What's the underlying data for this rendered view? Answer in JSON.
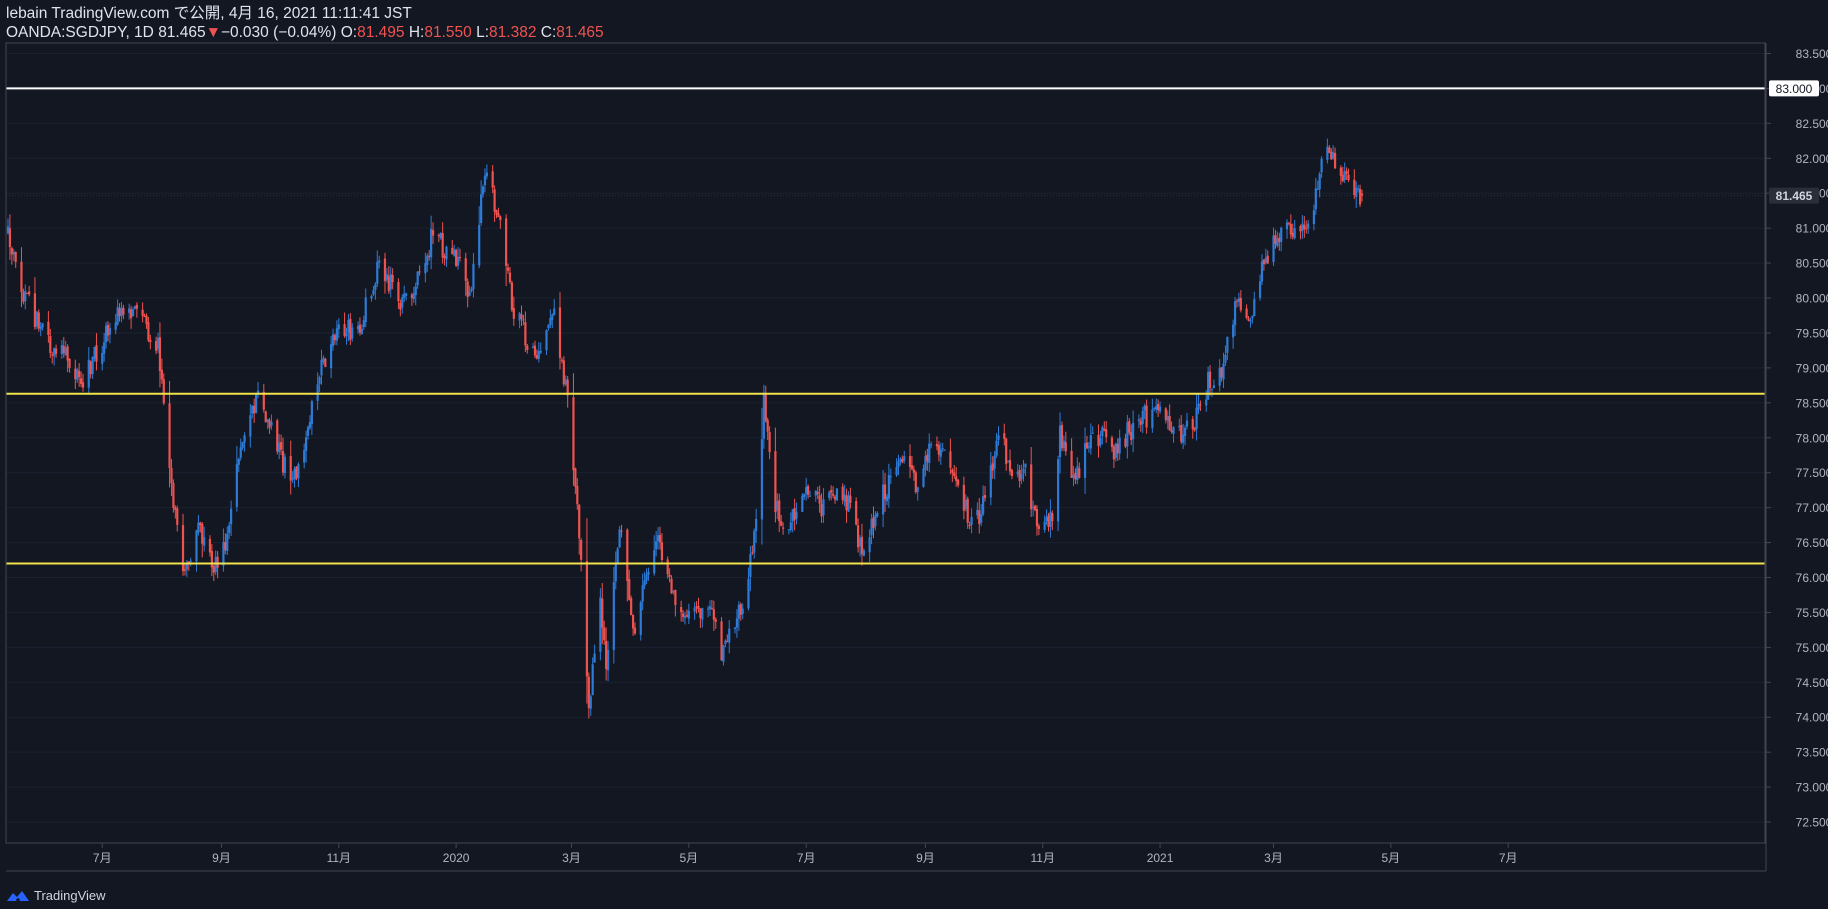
{
  "header": {
    "publish_line": "lebain TradingView.com で公開, 4月 16, 2021 11:11:41 JST",
    "symbol": "OANDA:SGDJPY, 1D",
    "last": "81.465",
    "change_arrow": "▼",
    "change": "−0.030 (−0.04%)",
    "o_label": "O:",
    "o_value": "81.495",
    "h_label": "H:",
    "h_value": "81.550",
    "l_label": "L:",
    "l_value": "81.382",
    "c_label": "C:",
    "c_value": "81.465"
  },
  "footer": {
    "brand": "TradingView",
    "logo_icon": "tradingview-logo-icon"
  },
  "colors": {
    "background": "#131722",
    "up": "#2e7bd6",
    "down": "#ef5350",
    "axis_text": "#b2b5be",
    "border": "#434651",
    "horizontal_line_white": "#ffffff",
    "horizontal_line_yellow": "#f0e24b"
  },
  "chart_data": {
    "type": "candlestick",
    "symbol": "OANDA:SGDJPY",
    "interval": "1D",
    "ylim": [
      72.2,
      83.65
    ],
    "y_ticks": [
      "72.500",
      "73.000",
      "73.500",
      "74.000",
      "74.500",
      "75.000",
      "75.500",
      "76.000",
      "76.500",
      "77.000",
      "77.500",
      "78.000",
      "78.500",
      "79.000",
      "79.500",
      "80.000",
      "80.500",
      "81.000",
      "81.500",
      "82.000",
      "82.500",
      "83.000",
      "83.500"
    ],
    "x_ticks": [
      {
        "label": "7月",
        "date": "2019-07"
      },
      {
        "label": "9月",
        "date": "2019-09"
      },
      {
        "label": "11月",
        "date": "2019-11"
      },
      {
        "label": "2020",
        "date": "2020-01"
      },
      {
        "label": "3月",
        "date": "2020-03"
      },
      {
        "label": "5月",
        "date": "2020-05"
      },
      {
        "label": "7月",
        "date": "2020-07"
      },
      {
        "label": "9月",
        "date": "2020-09"
      },
      {
        "label": "11月",
        "date": "2020-11"
      },
      {
        "label": "2021",
        "date": "2021-01"
      },
      {
        "label": "3月",
        "date": "2021-03"
      },
      {
        "label": "5月",
        "date": "2021-05"
      },
      {
        "label": "7月",
        "date": "2021-07"
      }
    ],
    "horizontal_lines": [
      {
        "value": 83.0,
        "color": "white",
        "label": "83.000"
      },
      {
        "value": 78.63,
        "color": "yellow"
      },
      {
        "value": 76.2,
        "color": "yellow"
      }
    ],
    "last_price": {
      "value": 81.465,
      "label": "81.465"
    },
    "price_path": [
      {
        "date": "2019-05-13",
        "close": 80.9
      },
      {
        "date": "2019-05-20",
        "close": 80.1
      },
      {
        "date": "2019-06-05",
        "close": 79.3
      },
      {
        "date": "2019-06-10",
        "close": 79.4
      },
      {
        "date": "2019-06-20",
        "close": 78.8
      },
      {
        "date": "2019-06-28",
        "close": 79.2
      },
      {
        "date": "2019-07-10",
        "close": 79.9
      },
      {
        "date": "2019-07-22",
        "close": 79.7
      },
      {
        "date": "2019-07-30",
        "close": 79.3
      },
      {
        "date": "2019-08-02",
        "close": 78.4
      },
      {
        "date": "2019-08-06",
        "close": 77.2
      },
      {
        "date": "2019-08-13",
        "close": 76.0
      },
      {
        "date": "2019-08-20",
        "close": 76.8
      },
      {
        "date": "2019-08-27",
        "close": 76.1
      },
      {
        "date": "2019-09-03",
        "close": 76.4
      },
      {
        "date": "2019-09-10",
        "close": 77.7
      },
      {
        "date": "2019-09-20",
        "close": 78.6
      },
      {
        "date": "2019-09-27",
        "close": 78.1
      },
      {
        "date": "2019-10-03",
        "close": 77.6
      },
      {
        "date": "2019-10-08",
        "close": 77.4
      },
      {
        "date": "2019-10-14",
        "close": 77.9
      },
      {
        "date": "2019-10-22",
        "close": 79.0
      },
      {
        "date": "2019-10-31",
        "close": 79.5
      },
      {
        "date": "2019-11-12",
        "close": 79.6
      },
      {
        "date": "2019-11-22",
        "close": 80.5
      },
      {
        "date": "2019-12-03",
        "close": 79.9
      },
      {
        "date": "2019-12-11",
        "close": 80.2
      },
      {
        "date": "2019-12-20",
        "close": 80.9
      },
      {
        "date": "2020-01-02",
        "close": 80.5
      },
      {
        "date": "2020-01-08",
        "close": 80.0
      },
      {
        "date": "2020-01-13",
        "close": 81.2
      },
      {
        "date": "2020-01-17",
        "close": 81.8
      },
      {
        "date": "2020-01-24",
        "close": 81.1
      },
      {
        "date": "2020-01-31",
        "close": 79.8
      },
      {
        "date": "2020-02-07",
        "close": 79.4
      },
      {
        "date": "2020-02-14",
        "close": 79.2
      },
      {
        "date": "2020-02-21",
        "close": 79.9
      },
      {
        "date": "2020-02-25",
        "close": 79.0
      },
      {
        "date": "2020-02-28",
        "close": 78.5
      },
      {
        "date": "2020-03-03",
        "close": 77.3
      },
      {
        "date": "2020-03-06",
        "close": 76.3
      },
      {
        "date": "2020-03-10",
        "close": 74.2
      },
      {
        "date": "2020-03-16",
        "close": 75.6
      },
      {
        "date": "2020-03-19",
        "close": 74.6
      },
      {
        "date": "2020-03-26",
        "close": 76.7
      },
      {
        "date": "2020-04-03",
        "close": 75.2
      },
      {
        "date": "2020-04-09",
        "close": 76.1
      },
      {
        "date": "2020-04-16",
        "close": 76.5
      },
      {
        "date": "2020-04-23",
        "close": 75.7
      },
      {
        "date": "2020-05-01",
        "close": 75.4
      },
      {
        "date": "2020-05-11",
        "close": 75.7
      },
      {
        "date": "2020-05-18",
        "close": 74.9
      },
      {
        "date": "2020-05-25",
        "close": 75.3
      },
      {
        "date": "2020-06-01",
        "close": 76.0
      },
      {
        "date": "2020-06-05",
        "close": 76.9
      },
      {
        "date": "2020-06-09",
        "close": 78.5
      },
      {
        "date": "2020-06-15",
        "close": 77.0
      },
      {
        "date": "2020-06-22",
        "close": 76.7
      },
      {
        "date": "2020-06-30",
        "close": 77.2
      },
      {
        "date": "2020-07-10",
        "close": 77.0
      },
      {
        "date": "2020-07-21",
        "close": 77.2
      },
      {
        "date": "2020-07-31",
        "close": 76.3
      },
      {
        "date": "2020-08-07",
        "close": 77.0
      },
      {
        "date": "2020-08-14",
        "close": 77.4
      },
      {
        "date": "2020-08-21",
        "close": 77.8
      },
      {
        "date": "2020-08-28",
        "close": 77.3
      },
      {
        "date": "2020-09-04",
        "close": 77.9
      },
      {
        "date": "2020-09-11",
        "close": 77.7
      },
      {
        "date": "2020-09-18",
        "close": 77.4
      },
      {
        "date": "2020-09-25",
        "close": 76.7
      },
      {
        "date": "2020-10-02",
        "close": 77.1
      },
      {
        "date": "2020-10-09",
        "close": 78.0
      },
      {
        "date": "2020-10-16",
        "close": 77.6
      },
      {
        "date": "2020-10-23",
        "close": 77.5
      },
      {
        "date": "2020-10-30",
        "close": 76.6
      },
      {
        "date": "2020-11-06",
        "close": 76.8
      },
      {
        "date": "2020-11-10",
        "close": 78.1
      },
      {
        "date": "2020-11-18",
        "close": 77.4
      },
      {
        "date": "2020-11-25",
        "close": 77.9
      },
      {
        "date": "2020-12-02",
        "close": 78.0
      },
      {
        "date": "2020-12-09",
        "close": 77.8
      },
      {
        "date": "2020-12-16",
        "close": 78.1
      },
      {
        "date": "2020-12-23",
        "close": 78.3
      },
      {
        "date": "2021-01-05",
        "close": 78.3
      },
      {
        "date": "2021-01-12",
        "close": 78.0
      },
      {
        "date": "2021-01-19",
        "close": 78.2
      },
      {
        "date": "2021-01-26",
        "close": 78.8
      },
      {
        "date": "2021-02-02",
        "close": 78.9
      },
      {
        "date": "2021-02-09",
        "close": 79.9
      },
      {
        "date": "2021-02-16",
        "close": 79.7
      },
      {
        "date": "2021-02-23",
        "close": 80.4
      },
      {
        "date": "2021-03-02",
        "close": 80.8
      },
      {
        "date": "2021-03-09",
        "close": 81.0
      },
      {
        "date": "2021-03-16",
        "close": 81.0
      },
      {
        "date": "2021-03-23",
        "close": 81.4
      },
      {
        "date": "2021-03-29",
        "close": 82.3
      },
      {
        "date": "2021-04-05",
        "close": 81.7
      },
      {
        "date": "2021-04-12",
        "close": 81.5
      },
      {
        "date": "2021-04-16",
        "close": 81.465
      }
    ]
  }
}
